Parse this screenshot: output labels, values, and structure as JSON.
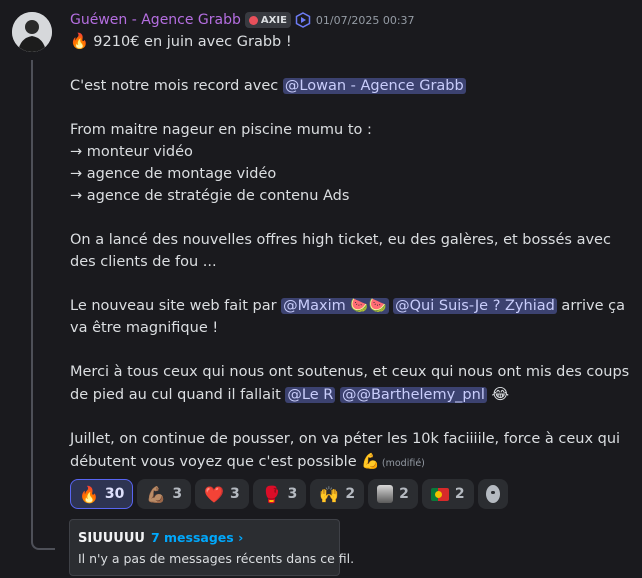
{
  "message": {
    "author": "Guéwen - Agence Grabb",
    "tag": "AXIE",
    "timestamp": "01/07/2025 00:37",
    "line1_emoji": "🔥",
    "line1_text": " 9210€ en juin avec Grabb !",
    "line2_text": "C'est notre mois record avec ",
    "mention_lowan": "@Lowan - Agence Grabb",
    "line3": "From maitre nageur en piscine mumu to :",
    "line4": "→ monteur vidéo",
    "line5": "→ agence de montage vidéo",
    "line6": "→ agence de stratégie de contenu Ads",
    "line7": "On a lancé des nouvelles offres high ticket, eu des galères, et bossés avec des clients de fou ...",
    "line8_pre": "Le nouveau site web fait par ",
    "mention_maxim": "@Maxim 🍉🍉",
    "mention_qui": "@Qui Suis-Je ? Zyhiad",
    "line8_post": " arrive ça va être magnifique !",
    "line9_pre": "Merci à tous ceux qui nous ont soutenus, et ceux qui nous ont mis des coups de pied au cul quand il fallait ",
    "mention_ler": "@Le R",
    "mention_barth": "@@Barthelemy_pnl",
    "line9_emoji": "😂",
    "line10": "Juillet, on continue de pousser, on va péter les 10k faciiiile, force à ceux qui débutent vous voyez que c'est possible ",
    "line10_emoji": "💪",
    "edited": "(modifié)"
  },
  "reactions": [
    {
      "emoji": "🔥",
      "count": "30",
      "active": true
    },
    {
      "emoji": "💪🏽",
      "count": "3"
    },
    {
      "emoji": "❤️",
      "count": "3"
    },
    {
      "emoji": "🥊",
      "count": "3"
    },
    {
      "emoji": "🙌",
      "count": "2"
    },
    {
      "emoji": "custom-avatar",
      "count": "2"
    },
    {
      "emoji": "flag-portugal",
      "count": "2"
    }
  ],
  "thread": {
    "name": "SIUUUUU",
    "messages_link": "7 messages ›",
    "subtitle": "Il n'y a pas de messages récents dans ce fil."
  },
  "colors": {
    "author": "#b46ee0",
    "mention_bg": "#3c4270",
    "link": "#00a8fc"
  }
}
